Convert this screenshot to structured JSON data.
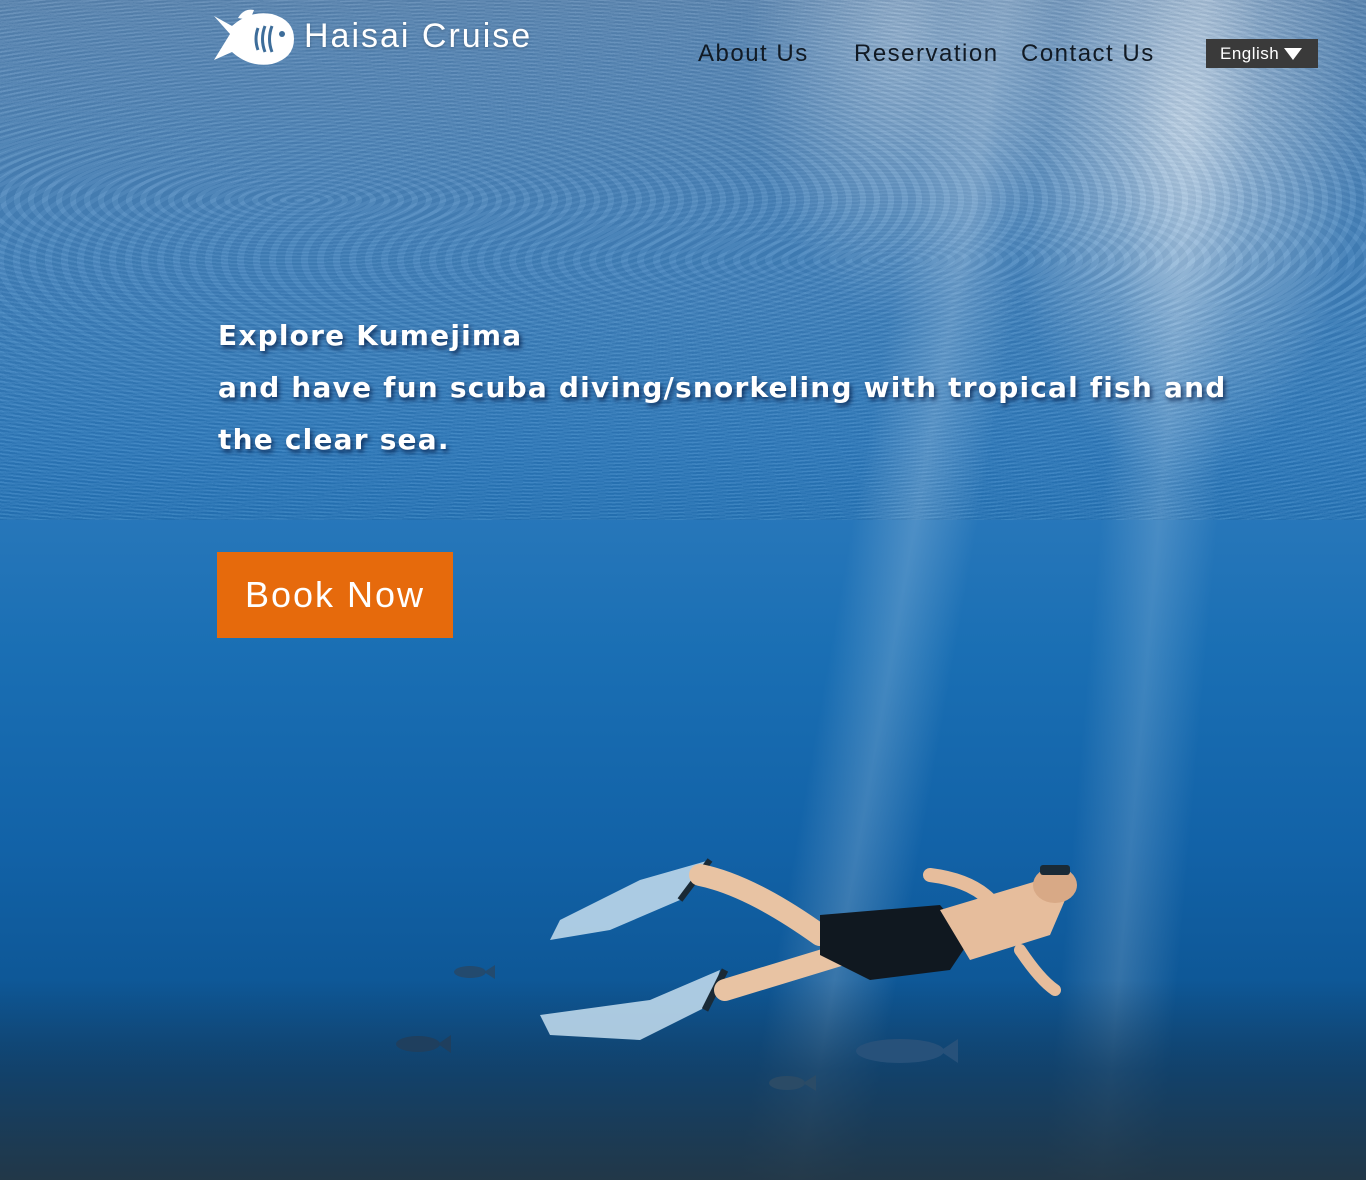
{
  "brand": {
    "name": "Haisai Cruise",
    "logo_icon": "fish-icon"
  },
  "nav": {
    "items": [
      {
        "label": "About Us"
      },
      {
        "label": "Reservation"
      },
      {
        "label": "Contact Us"
      }
    ]
  },
  "language": {
    "selected": "English",
    "icon": "caret-down-icon"
  },
  "hero": {
    "line1": "Explore Kumejima",
    "line2": "and have fun scuba diving/snorkeling with tropical fish and",
    "line3": "the clear sea.",
    "cta_label": "Book Now"
  },
  "colors": {
    "cta": "#e66a0c",
    "nav_text": "#111a24",
    "dropdown_bg": "#3a3a3a",
    "water": "#1a6fb4"
  }
}
